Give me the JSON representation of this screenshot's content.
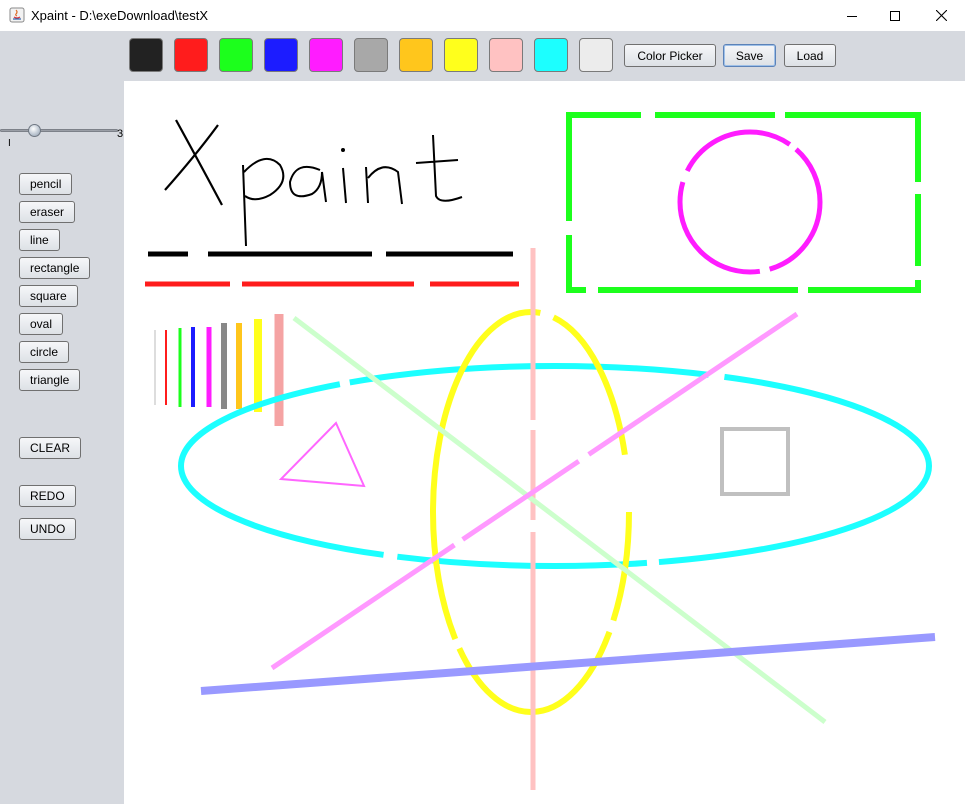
{
  "window": {
    "title": "Xpaint - D:\\exeDownload\\testX",
    "controls": [
      "minimize",
      "maximize",
      "close"
    ]
  },
  "palette": {
    "colors": [
      "#222222",
      "#ff1c1c",
      "#1cff1c",
      "#1c1cff",
      "#ff1cff",
      "#a8a8a8",
      "#ffc61c",
      "#ffff1c",
      "#ffc2c2",
      "#1cffff",
      "#ececec"
    ]
  },
  "toolbar": {
    "color_picker_label": "Color Picker",
    "save_label": "Save",
    "load_label": "Load"
  },
  "stroke_slider": {
    "min_label": "I",
    "max_label": "3",
    "value_fraction": 0.24
  },
  "tools": {
    "pencil": "pencil",
    "eraser": "eraser",
    "line": "line",
    "rectangle": "rectangle",
    "square": "square",
    "oval": "oval",
    "circle": "circle",
    "triangle": "triangle"
  },
  "actions": {
    "clear": "CLEAR",
    "redo": "REDO",
    "undo": "UNDO"
  },
  "canvas": {
    "handwritten_text": "Xpaint"
  }
}
